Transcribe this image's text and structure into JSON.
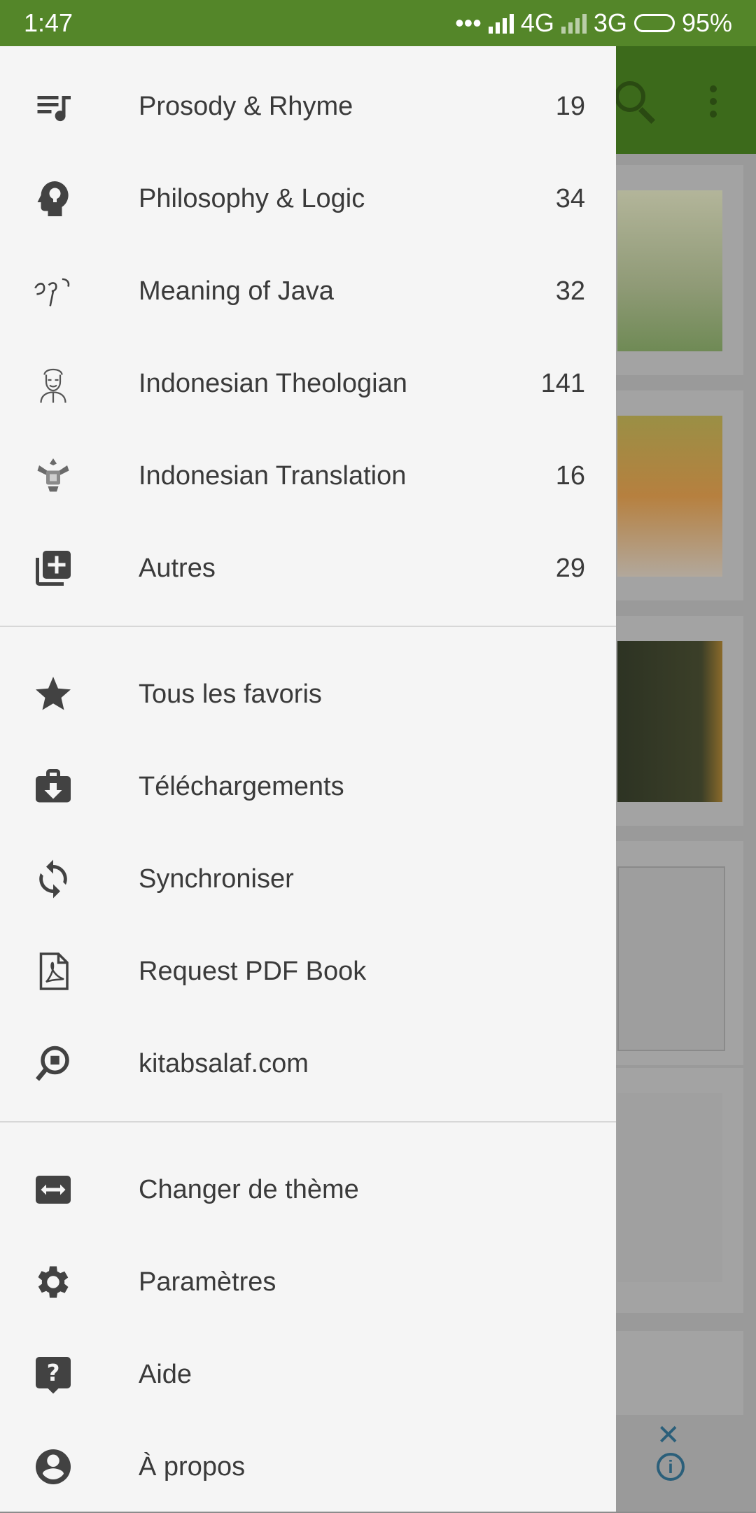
{
  "status_bar": {
    "time": "1:47",
    "dots": "•••",
    "network1": "4G",
    "network2": "3G",
    "battery": "95%",
    "battery_level": 0.95
  },
  "drawer": {
    "categories": [
      {
        "label": "Prosody & Rhyme",
        "count": "19",
        "icon": "music-list-icon"
      },
      {
        "label": "Philosophy & Logic",
        "count": "34",
        "icon": "head-bulb-icon"
      },
      {
        "label": "Meaning of Java",
        "count": "32",
        "icon": "java-script-icon"
      },
      {
        "label": "Indonesian Theologian",
        "count": "141",
        "icon": "scholar-portrait-icon"
      },
      {
        "label": "Indonesian Translation",
        "count": "16",
        "icon": "garuda-emblem-icon"
      },
      {
        "label": "Autres",
        "count": "29",
        "icon": "library-add-icon"
      }
    ],
    "actions": [
      {
        "label": "Tous les favoris",
        "icon": "star-icon"
      },
      {
        "label": "Téléchargements",
        "icon": "download-case-icon"
      },
      {
        "label": "Synchroniser",
        "icon": "sync-icon"
      },
      {
        "label": "Request PDF Book",
        "icon": "pdf-file-icon"
      },
      {
        "label": "kitabsalaf.com",
        "icon": "web-search-icon"
      }
    ],
    "settings": [
      {
        "label": "Changer de thème",
        "icon": "swap-theme-icon"
      },
      {
        "label": "Paramètres",
        "icon": "gear-icon"
      },
      {
        "label": "Aide",
        "icon": "help-icon"
      },
      {
        "label": "À propos",
        "icon": "account-icon"
      }
    ]
  },
  "colors": {
    "status_bar": "#548629",
    "drawer_bg": "#f5f5f5",
    "text": "#3a3a3a",
    "icon": "#424242"
  }
}
